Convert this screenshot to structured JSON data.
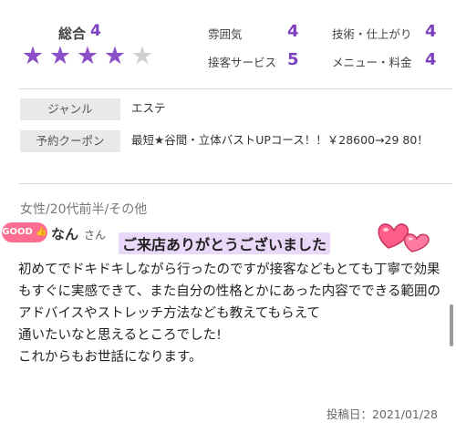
{
  "rating": {
    "overall_label": "総合",
    "overall_score": "4",
    "stars": 4,
    "stars_max": 5,
    "star_color": "#8b4fc8",
    "subs": [
      {
        "label": "雰囲気",
        "score": "4"
      },
      {
        "label": "技術・仕上がり",
        "score": "4"
      },
      {
        "label": "接客サービス",
        "score": "5"
      },
      {
        "label": "メニュー・料金",
        "score": "4"
      }
    ]
  },
  "info": [
    {
      "tag": "ジャンル",
      "value": "エステ"
    },
    {
      "tag": "予約クーポン",
      "value": "最短★谷間・立体バストUPコース！！￥28600→29 80！"
    }
  ],
  "review": {
    "meta": "女性/20代前半/その他",
    "badge": "GOOD",
    "name": "なん",
    "honorific": "さん",
    "thanks": "ご来店ありがとうございました",
    "body": [
      "初めてでドキドキしながら行ったのですが接客などもとても丁寧で効果もすぐに実感できて、また自分の性格とかにあった内容でできる範囲のアドバイスやストレッチ方法なども教えてもらえて",
      "通いたいなと思えるところでした!",
      "これからもお世話になります。"
    ],
    "date": "投稿日：2021/01/28"
  },
  "colors": {
    "accent": "#7b3fbf",
    "badge_pink": "#ff6e90",
    "tag_bg": "#e9e9e9"
  }
}
